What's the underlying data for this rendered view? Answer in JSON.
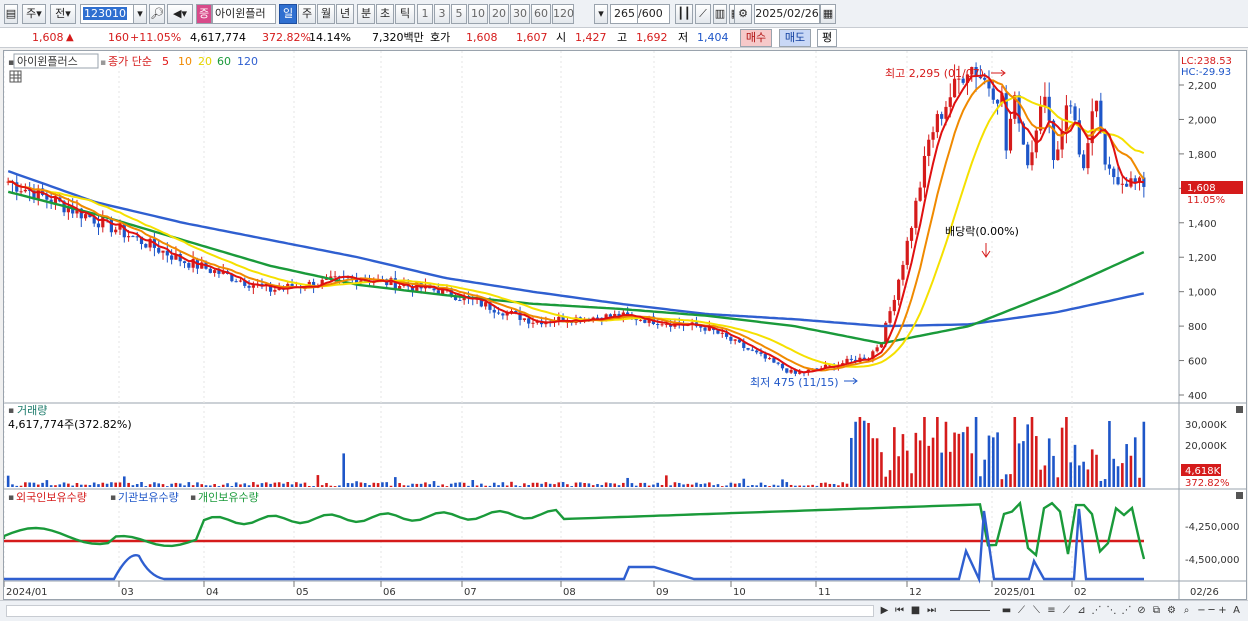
{
  "toolbar": {
    "period_label": "주",
    "prev_label": "전",
    "code": "123010",
    "stock_flag": "증",
    "stock_name": "아이윈플러",
    "tf_day": "일",
    "tf_week": "주",
    "tf_month": "월",
    "tf_year": "년",
    "tf_min": "분",
    "tf_sec": "초",
    "tf_tick": "틱",
    "tf_numbers": [
      "1",
      "3",
      "5",
      "10",
      "20",
      "30",
      "60",
      "120"
    ],
    "count": "265",
    "count_total": "/600",
    "date": "2025/02/26"
  },
  "quote": {
    "price": "1,608",
    "change": "160",
    "change_pct": "+11.05%",
    "volume": "4,617,774",
    "vol_ratio": "372.82%",
    "turnover": "14.14%",
    "amount": "7,320백만",
    "bid_label": "호가",
    "bid1": "1,608",
    "bid2": "1,607",
    "open_label": "시",
    "open": "1,427",
    "high_label": "고",
    "high": "1,692",
    "low_label": "저",
    "low": "1,404",
    "buy_label": "매수",
    "sell_label": "매도",
    "eval_label": "평"
  },
  "price_panel": {
    "stock_name": "아이윈플러스",
    "ma_label": "종가 단순",
    "ma_periods": [
      "5",
      "10",
      "20",
      "60",
      "120"
    ],
    "lc": "LC:238.53",
    "hc": "HC:-29.93",
    "max_annotation": "최고 2,295 (01/07)",
    "min_annotation": "최저 475 (11/15)",
    "dividend_annotation": "배당락(0.00%)",
    "current_price": "1,608",
    "current_pct": "11.05%"
  },
  "volume_panel": {
    "title": "거래량",
    "value": "4,617,774주(372.82%)",
    "current": "4,618K",
    "current_pct": "372.82%"
  },
  "holdings_panel": {
    "series": [
      "외국인보유수량",
      "기관보유수량",
      "개인보유수량"
    ]
  },
  "colors": {
    "up": "#d51b1b",
    "down": "#1e56c8",
    "ma5": "#e01010",
    "ma10": "#f08a00",
    "ma20": "#f5e000",
    "ma60": "#1a9a3a",
    "ma120": "#2f5fd0"
  },
  "chart_data": [
    {
      "type": "line",
      "title": "아이윈플러스",
      "x": [
        "2024/01",
        "03",
        "04",
        "05",
        "06",
        "07",
        "08",
        "09",
        "10",
        "11",
        "12",
        "2025/01",
        "02",
        "02/26"
      ],
      "ylim": [
        400,
        2300
      ],
      "yticks": [
        "400",
        "600",
        "800",
        "1,000",
        "1,200",
        "1,400",
        "1,600",
        "1,800",
        "2,000",
        "2,200"
      ],
      "series": [
        {
          "name": "종가",
          "values": [
            1640,
            1420,
            1180,
            1010,
            1080,
            1000,
            830,
            860,
            790,
            520,
            640,
            1680,
            1800,
            1608
          ]
        },
        {
          "name": "120",
          "values": [
            1700,
            1520,
            1400,
            1300,
            1200,
            1080,
            1000,
            930,
            870,
            840,
            800,
            810,
            880,
            990
          ]
        },
        {
          "name": "60",
          "values": [
            1580,
            1450,
            1300,
            1150,
            1040,
            980,
            930,
            900,
            860,
            800,
            700,
            800,
            1000,
            1230
          ]
        }
      ]
    },
    {
      "type": "bar",
      "title": "거래량",
      "ylim": [
        0,
        35000
      ],
      "yticks": [
        "20,000K",
        "30,000K"
      ],
      "values_k": [
        4618
      ]
    },
    {
      "type": "line",
      "title": "보유수량",
      "yticks": [
        "-4,250,000",
        "-4,500,000"
      ]
    }
  ]
}
